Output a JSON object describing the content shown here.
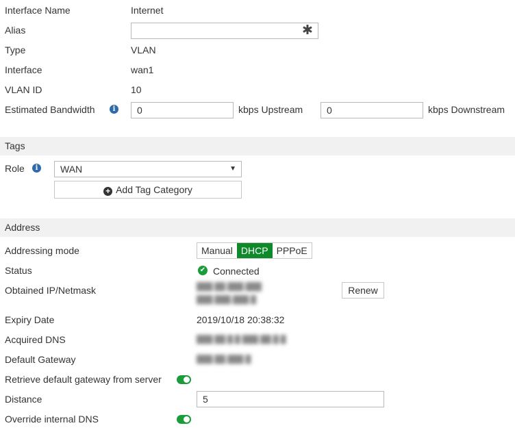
{
  "fields": {
    "interface_name": {
      "label": "Interface Name",
      "value": "Internet"
    },
    "alias": {
      "label": "Alias",
      "value": ""
    },
    "type": {
      "label": "Type",
      "value": "VLAN"
    },
    "interface": {
      "label": "Interface",
      "value": "wan1"
    },
    "vlan_id": {
      "label": "VLAN ID",
      "value": "10"
    },
    "bandwidth": {
      "label": "Estimated Bandwidth",
      "upstream_value": "0",
      "upstream_unit": "kbps Upstream",
      "downstream_value": "0",
      "downstream_unit": "kbps Downstream"
    }
  },
  "tags": {
    "section_title": "Tags",
    "role_label": "Role",
    "role_value": "WAN",
    "add_tag_label": "Add Tag Category"
  },
  "address": {
    "section_title": "Address",
    "addressing_mode_label": "Addressing mode",
    "modes": [
      "Manual",
      "DHCP",
      "PPPoE"
    ],
    "status_label": "Status",
    "status_value": "Connected",
    "obtained_ip_label": "Obtained IP/Netmask",
    "obtained_ip_line1": "███.██.███.███",
    "obtained_ip_line2": "███.███.███.█",
    "renew_label": "Renew",
    "expiry_label": "Expiry Date",
    "expiry_value": "2019/10/18 20:38:32",
    "dns_label": "Acquired DNS",
    "dns_value": "███.██.█.█ ███.██.█.█",
    "gateway_label": "Default Gateway",
    "gateway_value": "███.██.███.█",
    "retrieve_gw_label": "Retrieve default gateway from server",
    "distance_label": "Distance",
    "distance_value": "5",
    "override_dns_label": "Override internal DNS"
  },
  "colors": {
    "accent": "#0e8a2a",
    "toggle": "#1b9c3a",
    "info": "#2f6bab"
  },
  "icons": {
    "info": "info-icon",
    "alias_required": "asterisk-icon",
    "dropdown": "caret-down-icon",
    "add": "plus-circle-icon",
    "status": "check-circle-icon"
  }
}
